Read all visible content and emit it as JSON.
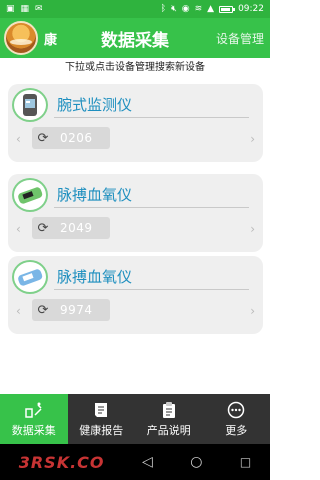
{
  "status_bar": {
    "time": "09:22"
  },
  "header": {
    "user_name": "康",
    "title": "数据采集",
    "manage_label": "设备管理"
  },
  "hint": "下拉或点击设备管理搜索新设备",
  "devices": [
    {
      "name": "腕式监测仪",
      "code": "0206",
      "icon": "wrist-monitor-icon"
    },
    {
      "name": "脉搏血氧仪",
      "code": "2049",
      "icon": "pulse-oximeter-green-icon"
    },
    {
      "name": "脉搏血氧仪",
      "code": "9974",
      "icon": "pulse-oximeter-blue-icon"
    }
  ],
  "bottom_nav": [
    {
      "label": "数据采集",
      "icon": "data-collect-icon",
      "active": true
    },
    {
      "label": "健康报告",
      "icon": "report-icon",
      "active": false
    },
    {
      "label": "产品说明",
      "icon": "clipboard-icon",
      "active": false
    },
    {
      "label": "更多",
      "icon": "more-icon",
      "active": false
    }
  ],
  "watermark": "3RSK.CO",
  "colors": {
    "brand_green": "#37c24a",
    "device_name_blue": "#1e8fbf",
    "nav_dark": "#333333"
  }
}
